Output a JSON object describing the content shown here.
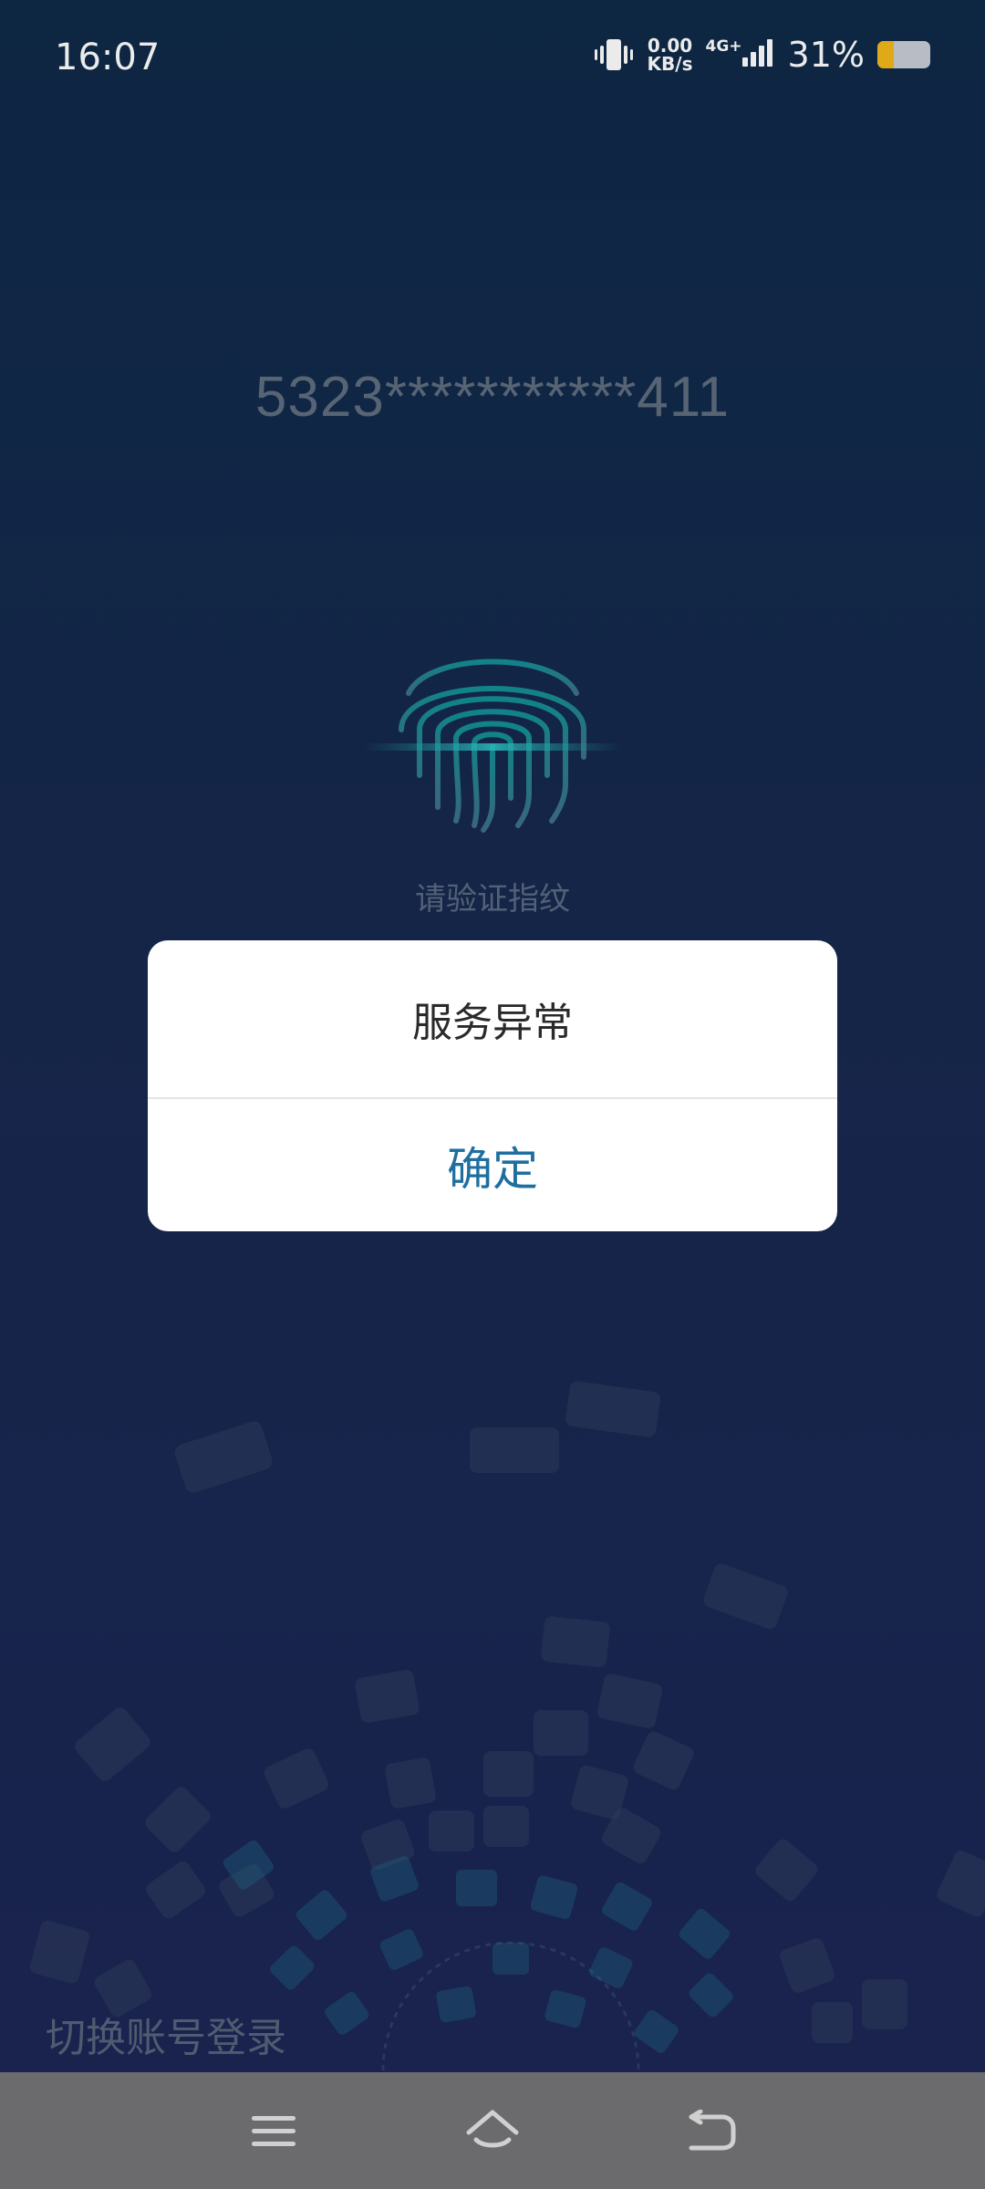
{
  "status_bar": {
    "time": "16:07",
    "net_speed_value": "0.00",
    "net_speed_unit": "KB/s",
    "network_type": "4G+",
    "battery_percent": "31%",
    "battery_level": 0.31,
    "icons": [
      "vibrate-icon",
      "signal-icon",
      "battery-icon"
    ]
  },
  "account": {
    "masked_number": "5323***********411"
  },
  "fingerprint": {
    "icon": "fingerprint-icon",
    "hint": "请验证指纹"
  },
  "dialog": {
    "message": "服务异常",
    "confirm_label": "确定"
  },
  "footer": {
    "switch_account_label": "切换账号登录"
  },
  "nav_bar": {
    "icons": [
      "menu-icon",
      "home-icon",
      "back-icon"
    ]
  },
  "colors": {
    "background_top": "#0f2a48",
    "background_bottom": "#1d2656",
    "accent": "#1e6fa0",
    "battery": "#f2b81a"
  }
}
